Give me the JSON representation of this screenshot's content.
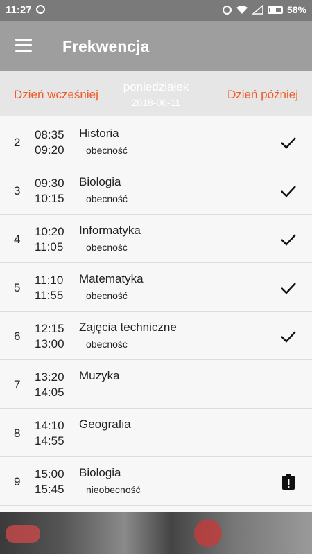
{
  "status_bar": {
    "time": "11:27",
    "battery": "58%",
    "battery_level": 0.58
  },
  "app_bar": {
    "title": "Frekwencja",
    "menu_icon": "hamburger-menu-icon"
  },
  "date_nav": {
    "prev_label": "Dzień wcześniej",
    "day_name": "poniedziałek",
    "date": "2018-06-11",
    "next_label": "Dzień później"
  },
  "lessons": [
    {
      "number": "2",
      "start": "08:35",
      "end": "09:20",
      "subject": "Historia",
      "status": "obecność",
      "icon": "check-icon"
    },
    {
      "number": "3",
      "start": "09:30",
      "end": "10:15",
      "subject": "Biologia",
      "status": "obecność",
      "icon": "check-icon"
    },
    {
      "number": "4",
      "start": "10:20",
      "end": "11:05",
      "subject": "Informatyka",
      "status": "obecność",
      "icon": "check-icon"
    },
    {
      "number": "5",
      "start": "11:10",
      "end": "11:55",
      "subject": "Matematyka",
      "status": "obecność",
      "icon": "check-icon"
    },
    {
      "number": "6",
      "start": "12:15",
      "end": "13:00",
      "subject": "Zajęcia techniczne",
      "status": "obecność",
      "icon": "check-icon"
    },
    {
      "number": "7",
      "start": "13:20",
      "end": "14:05",
      "subject": "Muzyka",
      "status": "",
      "icon": ""
    },
    {
      "number": "8",
      "start": "14:10",
      "end": "14:55",
      "subject": "Geografia",
      "status": "",
      "icon": ""
    },
    {
      "number": "9",
      "start": "15:00",
      "end": "15:45",
      "subject": "Biologia",
      "status": "nieobecność",
      "icon": "absence-clipboard-icon"
    }
  ],
  "colors": {
    "accent": "#f05a28",
    "app_bar": "#9e9e9e",
    "status_bar": "#7a7a7a",
    "date_bar": "#e6e6e6"
  }
}
